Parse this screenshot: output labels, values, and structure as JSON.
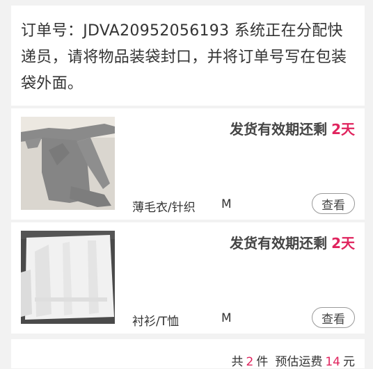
{
  "notice": {
    "text": "订单号：JDVA20952056193 系统正在分配快递员，请将物品装袋封口，并将订单号写在包装袋外面。"
  },
  "items": [
    {
      "deadline_label": "发货有效期还剩",
      "deadline_value": "2天",
      "category": "薄毛衣/针织",
      "size": "M",
      "view_label": "查看",
      "thumb_desc": "gray-sweater-photo"
    },
    {
      "deadline_label": "发货有效期还剩",
      "deadline_value": "2天",
      "category": "衬衫/T恤",
      "size": "M",
      "view_label": "查看",
      "thumb_desc": "white-shirt-photo"
    }
  ],
  "summary": {
    "prefix": "共",
    "count": "2",
    "count_unit": "件",
    "fee_label": "预估运费",
    "fee_value": "14",
    "fee_unit": "元"
  },
  "colors": {
    "accent": "#e0245e",
    "background": "#f2f2f2"
  }
}
